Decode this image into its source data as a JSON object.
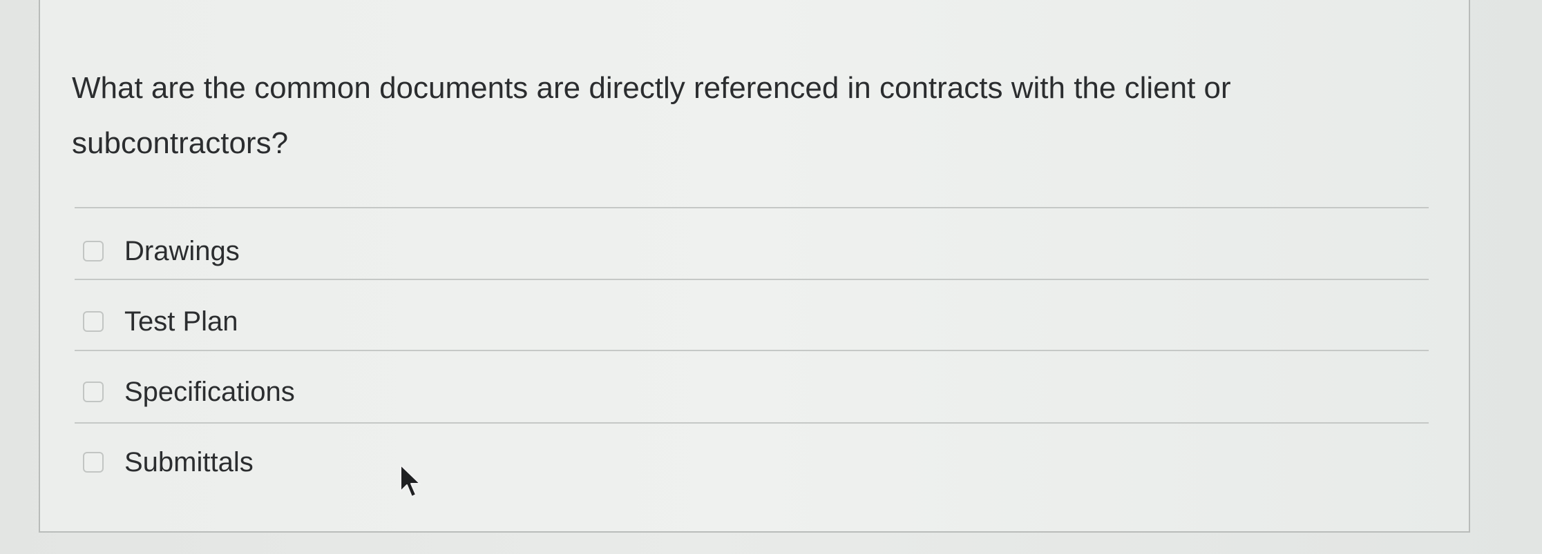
{
  "question": {
    "text": "What are the common documents are directly referenced in contracts with the client or subcontractors?"
  },
  "options": [
    {
      "label": "Drawings",
      "checked": false
    },
    {
      "label": "Test Plan",
      "checked": false
    },
    {
      "label": "Specifications",
      "checked": false
    },
    {
      "label": "Submittals",
      "checked": false
    }
  ],
  "cursor": {
    "icon": "mouse-pointer-icon"
  }
}
